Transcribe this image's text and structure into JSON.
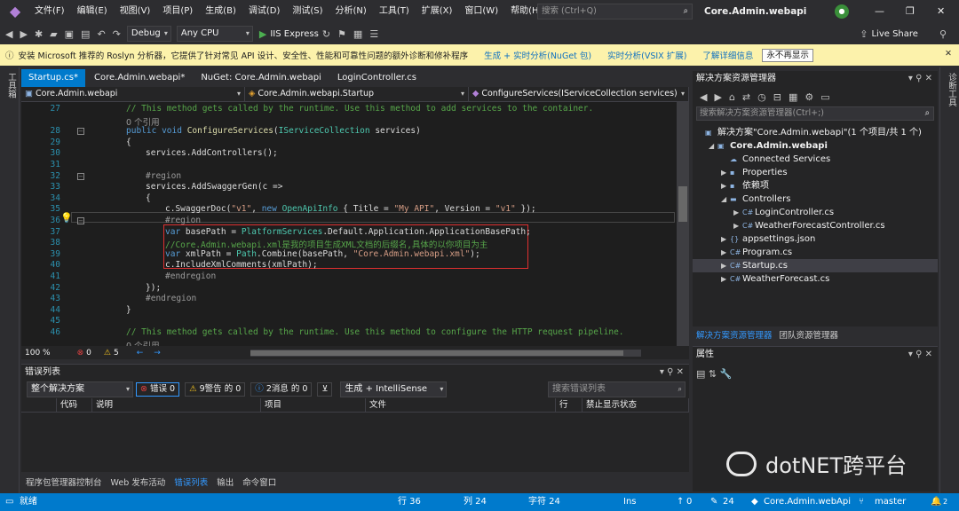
{
  "menu": [
    "文件(F)",
    "编辑(E)",
    "视图(V)",
    "项目(P)",
    "生成(B)",
    "调试(D)",
    "测试(S)",
    "分析(N)",
    "工具(T)",
    "扩展(X)",
    "窗口(W)",
    "帮助(H)"
  ],
  "search": {
    "placeholder": "搜索 (Ctrl+Q)"
  },
  "window_title": "Core.Admin.webapi",
  "toolbar": {
    "config": "Debug",
    "platform": "Any CPU",
    "run": "IIS Express",
    "live_share": "Live Share"
  },
  "infobar": {
    "message": "安装 Microsoft 推荐的 Roslyn 分析器，它提供了针对常见 API 设计、安全性、性能和可靠性问题的额外诊断和修补程序",
    "link1": "生成 + 实时分析(NuGet 包)",
    "link2": "实时分析(VSIX 扩展)",
    "link3": "了解详细信息",
    "button": "永不再显示"
  },
  "left_strip": "工具箱",
  "right_strip": "诊断工具",
  "tabs": [
    "Startup.cs*",
    "Core.Admin.webapi*",
    "NuGet: Core.Admin.webapi",
    "LoginController.cs"
  ],
  "nav": {
    "project": "Core.Admin.webapi",
    "class": "Core.Admin.webapi.Startup",
    "member": "ConfigureServices(IServiceCollection services)"
  },
  "code_lines": [
    {
      "n": "27",
      "t": "// This method gets called by the runtime. Use this method to add services to the container.",
      "c": "cm",
      "i": 0
    },
    {
      "n": "",
      "t": "0 个引用",
      "c": "ref",
      "i": 0
    },
    {
      "n": "28",
      "t": "public void ConfigureServices(IServiceCollection services)",
      "c": "mix1",
      "i": 0
    },
    {
      "n": "29",
      "t": "{",
      "c": "",
      "i": 0
    },
    {
      "n": "30",
      "t": "services.AddControllers();",
      "c": "",
      "i": 1
    },
    {
      "n": "31",
      "t": "",
      "c": "",
      "i": 0
    },
    {
      "n": "32",
      "t": "#region",
      "c": "rg",
      "i": 1
    },
    {
      "n": "33",
      "t": "services.AddSwaggerGen(c =>",
      "c": "",
      "i": 1
    },
    {
      "n": "34",
      "t": "{",
      "c": "",
      "i": 1
    },
    {
      "n": "35",
      "t": "c.SwaggerDoc(\"v1\", new OpenApiInfo { Title = \"My API\", Version = \"v1\" });",
      "c": "mix2",
      "i": 2
    },
    {
      "n": "36",
      "t": "#region",
      "c": "rg",
      "i": 2
    },
    {
      "n": "37",
      "t": "var basePath = PlatformServices.Default.Application.ApplicationBasePath;",
      "c": "mix3",
      "i": 2
    },
    {
      "n": "38",
      "t": "//Core.Admin.webapi.xml是我的项目生成XML文档的后缀名,具体的以你项目为主",
      "c": "cm",
      "i": 2
    },
    {
      "n": "39",
      "t": "var xmlPath = Path.Combine(basePath, \"Core.Admin.webapi.xml\");",
      "c": "mix4",
      "i": 2
    },
    {
      "n": "40",
      "t": "c.IncludeXmlComments(xmlPath);",
      "c": "",
      "i": 2
    },
    {
      "n": "41",
      "t": "#endregion",
      "c": "rg",
      "i": 2
    },
    {
      "n": "42",
      "t": "});",
      "c": "",
      "i": 1
    },
    {
      "n": "43",
      "t": "#endregion",
      "c": "rg",
      "i": 1
    },
    {
      "n": "44",
      "t": "}",
      "c": "",
      "i": 0
    },
    {
      "n": "45",
      "t": "",
      "c": "",
      "i": 0
    },
    {
      "n": "46",
      "t": "// This method gets called by the runtime. Use this method to configure the HTTP request pipeline.",
      "c": "cm",
      "i": 0
    },
    {
      "n": "",
      "t": "0 个引用",
      "c": "ref",
      "i": 0
    }
  ],
  "editor_status": {
    "zoom": "100 %",
    "errors": "0",
    "warnings": "5"
  },
  "error_panel": {
    "title": "错误列表",
    "scope": "整个解决方案",
    "errors": "错误 0",
    "warnings": "9警告 的 0",
    "messages": "2消息 的 0",
    "build": "生成 + IntelliSense",
    "search": "搜索错误列表",
    "cols": [
      "代码",
      "说明",
      "项目",
      "文件",
      "行",
      "禁止显示状态"
    ]
  },
  "bottom_tabs": [
    "程序包管理器控制台",
    "Web 发布活动",
    "错误列表",
    "输出",
    "命令窗口"
  ],
  "solution": {
    "title": "解决方案资源管理器",
    "search": "搜索解决方案资源管理器(Ctrl+;)",
    "items": [
      {
        "label": "解决方案\"Core.Admin.webapi\"(1 个项目/共 1 个)",
        "lvl": 0,
        "tg": "",
        "ic": "▣"
      },
      {
        "label": "Core.Admin.webapi",
        "lvl": 1,
        "tg": "◢",
        "ic": "▣",
        "bold": true
      },
      {
        "label": "Connected Services",
        "lvl": 2,
        "tg": "",
        "ic": "☁"
      },
      {
        "label": "Properties",
        "lvl": 2,
        "tg": "▶",
        "ic": "▪"
      },
      {
        "label": "依赖项",
        "lvl": 2,
        "tg": "▶",
        "ic": "▪"
      },
      {
        "label": "Controllers",
        "lvl": 2,
        "tg": "◢",
        "ic": "▬"
      },
      {
        "label": "LoginController.cs",
        "lvl": 3,
        "tg": "▶",
        "ic": "C#"
      },
      {
        "label": "WeatherForecastController.cs",
        "lvl": 3,
        "tg": "▶",
        "ic": "C#"
      },
      {
        "label": "appsettings.json",
        "lvl": 2,
        "tg": "▶",
        "ic": "{}"
      },
      {
        "label": "Program.cs",
        "lvl": 2,
        "tg": "▶",
        "ic": "C#"
      },
      {
        "label": "Startup.cs",
        "lvl": 2,
        "tg": "▶",
        "ic": "C#",
        "sel": true
      },
      {
        "label": "WeatherForecast.cs",
        "lvl": 2,
        "tg": "▶",
        "ic": "C#"
      }
    ],
    "tabs": [
      "解决方案资源管理器",
      "团队资源管理器"
    ]
  },
  "properties": {
    "title": "属性"
  },
  "watermark": "dotNET跨平台",
  "status": {
    "ready": "就绪",
    "line": "行 36",
    "col": "列 24",
    "char": "字符 24",
    "ins": "Ins",
    "up": "0",
    "pencil": "24",
    "repo": "Core.Admin.webApi",
    "branch": "master",
    "bell": "2"
  }
}
